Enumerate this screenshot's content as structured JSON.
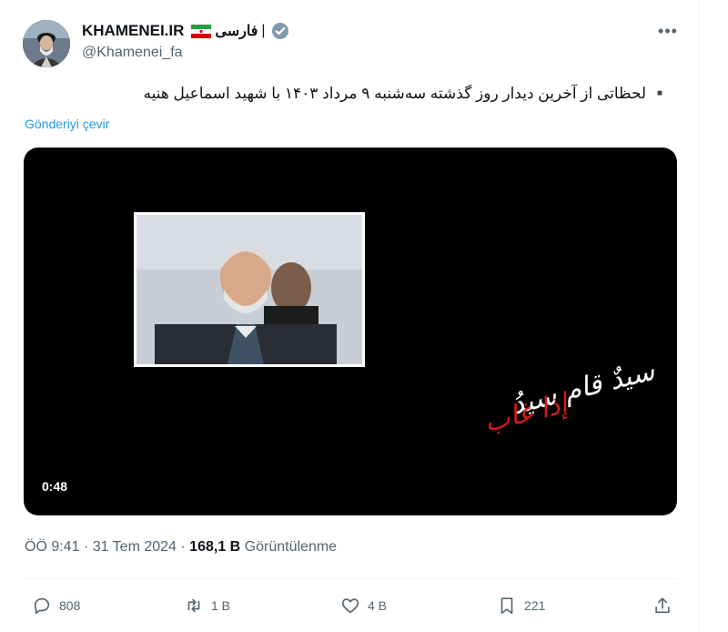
{
  "author": {
    "name": "KHAMENEI.IR",
    "separator": "|",
    "farsi_label": "فارسی",
    "handle": "@Khamenei_fa",
    "verified": true
  },
  "post": {
    "text": "▪️ لحظاتی از آخرین دیدار روز گذشته سه‌شنبه ۹ مرداد ۱۴۰۳ با شهید اسماعیل هنیه",
    "translate_label": "Gönderiyi çevir"
  },
  "media": {
    "duration": "0:48",
    "calligraphy_red": "إذا غاب",
    "calligraphy_white": "سيدٌ قام سيدُ"
  },
  "meta": {
    "time": "ÖÖ 9:41",
    "date": "31 Tem 2024",
    "dot": "·",
    "views_count": "168,1 B",
    "views_label": "Görüntülenme"
  },
  "actions": {
    "replies": "808",
    "reposts": "1 B",
    "likes": "4 B",
    "bookmarks": "221"
  },
  "colors": {
    "accent": "#1d9bf0",
    "muted": "#536471",
    "text": "#0f1419",
    "calligraphy_red": "#d11a1a"
  },
  "icons": [
    "avatar",
    "iran-flag-icon",
    "verified-badge-icon",
    "more-icon",
    "reply-icon",
    "repost-icon",
    "like-icon",
    "bookmark-icon",
    "share-icon"
  ]
}
